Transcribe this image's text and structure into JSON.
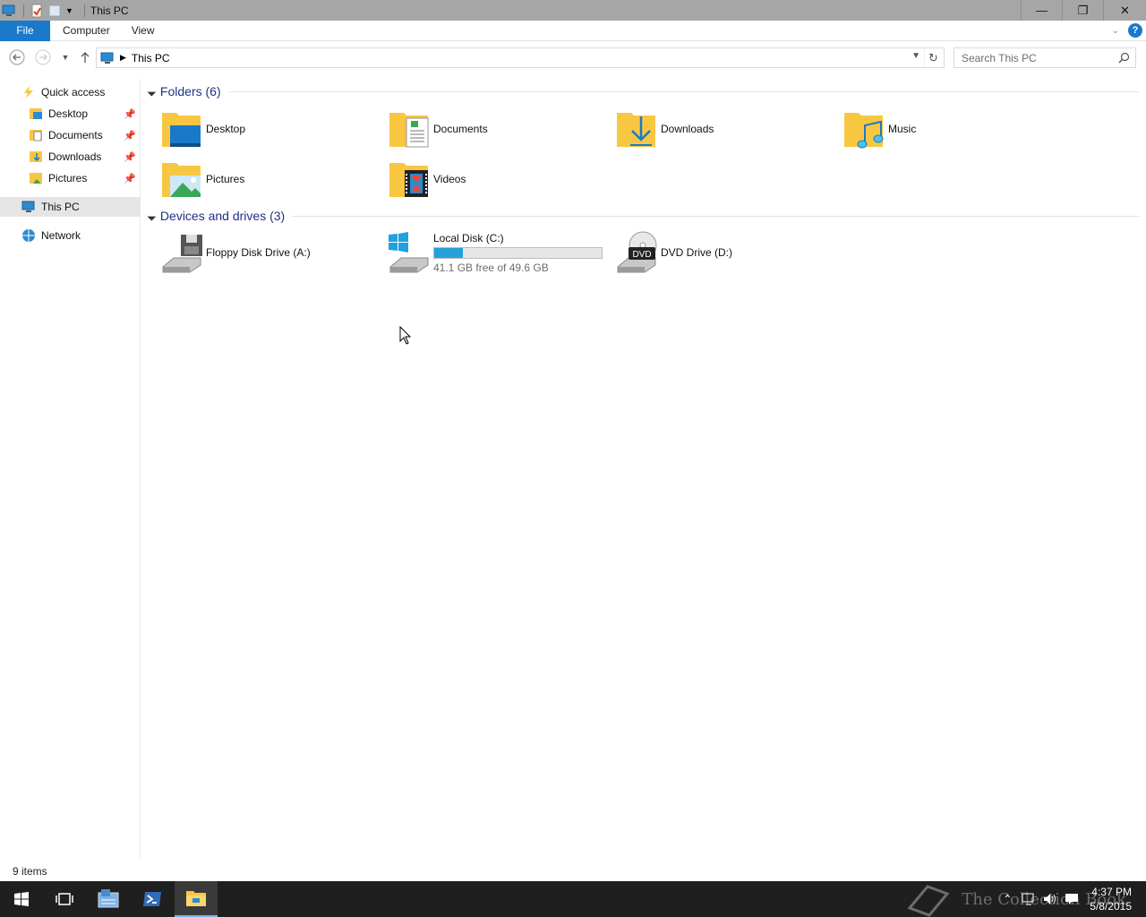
{
  "window": {
    "title": "This PC",
    "controls": {
      "minimize": "—",
      "restore": "❐",
      "close": "✕"
    }
  },
  "ribbon": {
    "tabs": [
      "File",
      "Computer",
      "View"
    ],
    "help": "?"
  },
  "address": {
    "crumb": "This PC",
    "search_placeholder": "Search This PC"
  },
  "nav_pane": {
    "quick_access": "Quick access",
    "pinned": [
      {
        "label": "Desktop",
        "icon": "desktop-icon"
      },
      {
        "label": "Documents",
        "icon": "documents-icon"
      },
      {
        "label": "Downloads",
        "icon": "downloads-icon"
      },
      {
        "label": "Pictures",
        "icon": "pictures-icon"
      }
    ],
    "this_pc": "This PC",
    "network": "Network"
  },
  "folders": {
    "header": "Folders (6)",
    "items": [
      "Desktop",
      "Documents",
      "Downloads",
      "Music",
      "Pictures",
      "Videos"
    ]
  },
  "devices": {
    "header": "Devices and drives (3)",
    "floppy": "Floppy Disk Drive (A:)",
    "local_disk": {
      "label": "Local Disk (C:)",
      "free_text": "41.1 GB free of 49.6 GB",
      "used_fraction": 0.17
    },
    "dvd": {
      "label": "DVD Drive (D:)",
      "badge": "DVD"
    }
  },
  "status": {
    "items": "9 items"
  },
  "taskbar": {
    "time": "4:37 PM",
    "date": "5/8/2015",
    "watermark": "The Collection Book"
  },
  "colors": {
    "accent": "#1979ca",
    "folder": "#f8c742",
    "bar_fill": "#26a0da",
    "group_header": "#1e3287"
  }
}
